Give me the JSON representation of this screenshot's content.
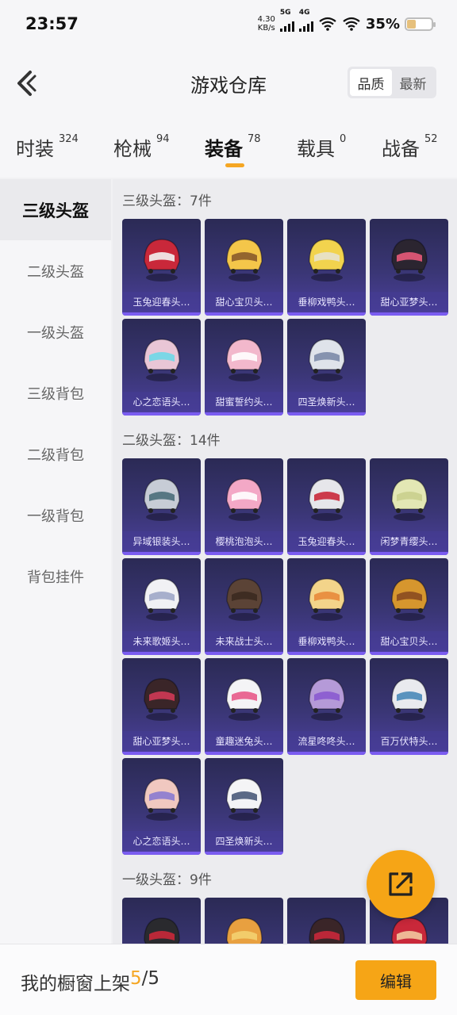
{
  "status": {
    "time": "23:57",
    "speed_value": "4.30",
    "speed_unit": "KB/s",
    "net1": "5G",
    "net2": "4G",
    "battery": "35%"
  },
  "header": {
    "title": "游戏仓库",
    "sort_quality": "品质",
    "sort_latest": "最新"
  },
  "tabs": [
    {
      "label": "时装",
      "count": "324"
    },
    {
      "label": "枪械",
      "count": "94"
    },
    {
      "label": "装备",
      "count": "78"
    },
    {
      "label": "载具",
      "count": "0"
    },
    {
      "label": "战备",
      "count": "52"
    }
  ],
  "sidebar": [
    {
      "label": "三级头盔"
    },
    {
      "label": "二级头盔"
    },
    {
      "label": "一级头盔"
    },
    {
      "label": "三级背包"
    },
    {
      "label": "二级背包"
    },
    {
      "label": "一级背包"
    },
    {
      "label": "背包挂件"
    }
  ],
  "sections": [
    {
      "title": "三级头盔：7件",
      "items": [
        "玉兔迎春头…",
        "甜心宝贝头…",
        "垂柳戏鸭头…",
        "甜心亚梦头…",
        "心之恋语头…",
        "甜蜜誓约头…",
        "四圣焕新头…"
      ]
    },
    {
      "title": "二级头盔：14件",
      "items": [
        "异域银装头…",
        "樱桃泡泡头…",
        "玉兔迎春头…",
        "闲梦青缨头…",
        "未来歌姬头…",
        "未来战士头…",
        "垂柳戏鸭头…",
        "甜心宝贝头…",
        "甜心亚梦头…",
        "童趣迷兔头…",
        "流星咚咚头…",
        "百万伏特头…",
        "心之恋语头…",
        "四圣焕新头…"
      ]
    },
    {
      "title": "一级头盔：9件",
      "items": [
        "",
        "",
        "",
        ""
      ]
    }
  ],
  "bottom": {
    "shelf_prefix": "我的橱窗上架",
    "shelf_used": "5",
    "shelf_sep": "/",
    "shelf_total": "5",
    "edit_label": "编辑"
  },
  "colors": {
    "accent": "#f6a516",
    "card_top": "#2b2a55",
    "card_bottom": "#4b3f9c"
  },
  "icons": {
    "back": "chevron-left-icon",
    "share": "share-external-icon"
  }
}
